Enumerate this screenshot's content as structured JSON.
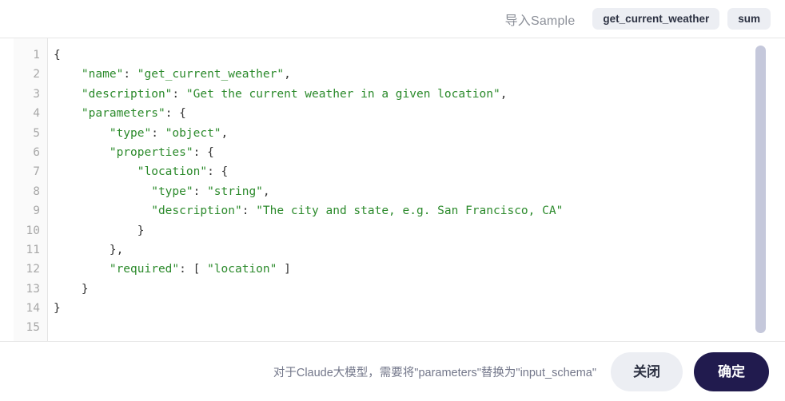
{
  "header": {
    "import_label": "导入Sample",
    "chips": [
      {
        "name": "chip-get-current-weather",
        "label": "get_current_weather"
      },
      {
        "name": "chip-sum",
        "label": "sum"
      }
    ]
  },
  "editor": {
    "line_numbers": [
      "1",
      "2",
      "3",
      "4",
      "5",
      "6",
      "7",
      "8",
      "9",
      "10",
      "11",
      "12",
      "13",
      "14",
      "15"
    ],
    "lines": [
      [
        {
          "t": "{",
          "c": "p"
        }
      ],
      [
        {
          "t": "    ",
          "c": "p"
        },
        {
          "t": "\"name\"",
          "c": "s"
        },
        {
          "t": ": ",
          "c": "p"
        },
        {
          "t": "\"get_current_weather\"",
          "c": "s"
        },
        {
          "t": ",",
          "c": "p"
        }
      ],
      [
        {
          "t": "    ",
          "c": "p"
        },
        {
          "t": "\"description\"",
          "c": "s"
        },
        {
          "t": ": ",
          "c": "p"
        },
        {
          "t": "\"Get the current weather in a given location\"",
          "c": "s"
        },
        {
          "t": ",",
          "c": "p"
        }
      ],
      [
        {
          "t": "    ",
          "c": "p"
        },
        {
          "t": "\"parameters\"",
          "c": "s"
        },
        {
          "t": ": {",
          "c": "p"
        }
      ],
      [
        {
          "t": "        ",
          "c": "p"
        },
        {
          "t": "\"type\"",
          "c": "s"
        },
        {
          "t": ": ",
          "c": "p"
        },
        {
          "t": "\"object\"",
          "c": "s"
        },
        {
          "t": ",",
          "c": "p"
        }
      ],
      [
        {
          "t": "        ",
          "c": "p"
        },
        {
          "t": "\"properties\"",
          "c": "s"
        },
        {
          "t": ": {",
          "c": "p"
        }
      ],
      [
        {
          "t": "            ",
          "c": "p"
        },
        {
          "t": "\"location\"",
          "c": "s"
        },
        {
          "t": ": {",
          "c": "p"
        }
      ],
      [
        {
          "t": "              ",
          "c": "p"
        },
        {
          "t": "\"type\"",
          "c": "s"
        },
        {
          "t": ": ",
          "c": "p"
        },
        {
          "t": "\"string\"",
          "c": "s"
        },
        {
          "t": ",",
          "c": "p"
        }
      ],
      [
        {
          "t": "              ",
          "c": "p"
        },
        {
          "t": "\"description\"",
          "c": "s"
        },
        {
          "t": ": ",
          "c": "p"
        },
        {
          "t": "\"The city and state, e.g. San Francisco, CA\"",
          "c": "s"
        }
      ],
      [
        {
          "t": "            }",
          "c": "p"
        }
      ],
      [
        {
          "t": "        },",
          "c": "p"
        }
      ],
      [
        {
          "t": "        ",
          "c": "p"
        },
        {
          "t": "\"required\"",
          "c": "s"
        },
        {
          "t": ": [ ",
          "c": "p"
        },
        {
          "t": "\"location\"",
          "c": "s"
        },
        {
          "t": " ]",
          "c": "p"
        }
      ],
      [
        {
          "t": "    }",
          "c": "p"
        }
      ],
      [
        {
          "t": "}",
          "c": "p"
        }
      ],
      [
        {
          "t": "",
          "c": "p"
        }
      ]
    ]
  },
  "footer": {
    "hint": "对于Claude大模型，需要将\"parameters\"替换为\"input_schema\"",
    "close_label": "关闭",
    "confirm_label": "确定"
  },
  "colors": {
    "chip_bg": "#eceef3",
    "string_green": "#2b8a2b",
    "punct_dark": "#333333",
    "primary_navy": "#211b4e",
    "scrollbar": "#c5c8db",
    "gutter_bg": "#fafafa",
    "line_number": "#a8a8a8",
    "hint_text": "#73778a"
  }
}
